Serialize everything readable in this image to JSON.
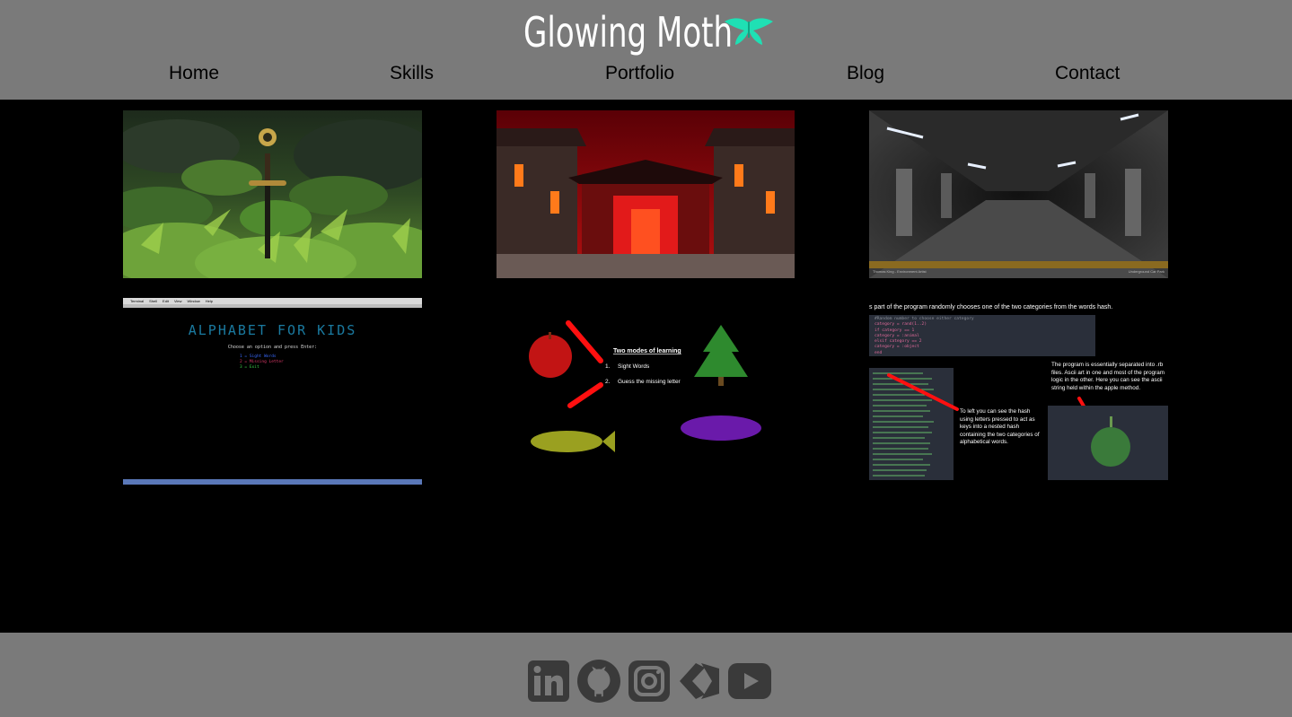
{
  "site": {
    "title": "Glowing Moth",
    "logo_icon": "moth-icon",
    "accent": "#20e0b0"
  },
  "nav": {
    "items": [
      {
        "label": "Home"
      },
      {
        "label": "Skills"
      },
      {
        "label": "Portfolio"
      },
      {
        "label": "Blog"
      },
      {
        "label": "Contact"
      }
    ]
  },
  "gallery": {
    "tiles": [
      {
        "subject": "sword in mossy forest"
      },
      {
        "subject": "red lit chinese temple courtyard"
      },
      {
        "subject": "underground car park",
        "caption_left": "Thomas King - Environment Artist",
        "caption_right": "Underground Car Park"
      },
      {
        "subject": "alphabet for kids terminal",
        "menubar": [
          "Terminal",
          "Shell",
          "Edit",
          "View",
          "Window",
          "Help"
        ],
        "heading": "ALPHABET FOR KIDS",
        "prompt": "Choose an option and press Enter:",
        "options": [
          "1 = Sight Words",
          "2 = Missing Letter",
          "3 = Exit"
        ]
      },
      {
        "subject": "two modes of learning",
        "heading": "Two modes of learning",
        "modes": [
          "Sight Words",
          "Guess the missing letter"
        ]
      },
      {
        "subject": "program code explanation",
        "top_text": "s part of the program randomly chooses one of the two categories from the words hash.",
        "code": [
          "#Random number to choose either category",
          "category = rand(1..2)",
          "if category == 1",
          "  category = :animal",
          "elsif category == 2",
          "  category = :object",
          "end"
        ],
        "right_text": "The program is essentially separated into .rb files. Ascii art in one and most of the program logic in the other. Here you can see the ascii string held within the apple method.",
        "mid_text": "To left you can see the hash using letters pressed to act as keys into a nested hash containing the two categories of alphabetical words."
      }
    ]
  },
  "footer": {
    "icons": [
      "linkedin-icon",
      "github-icon",
      "instagram-icon",
      "unity-icon",
      "youtube-icon"
    ]
  }
}
